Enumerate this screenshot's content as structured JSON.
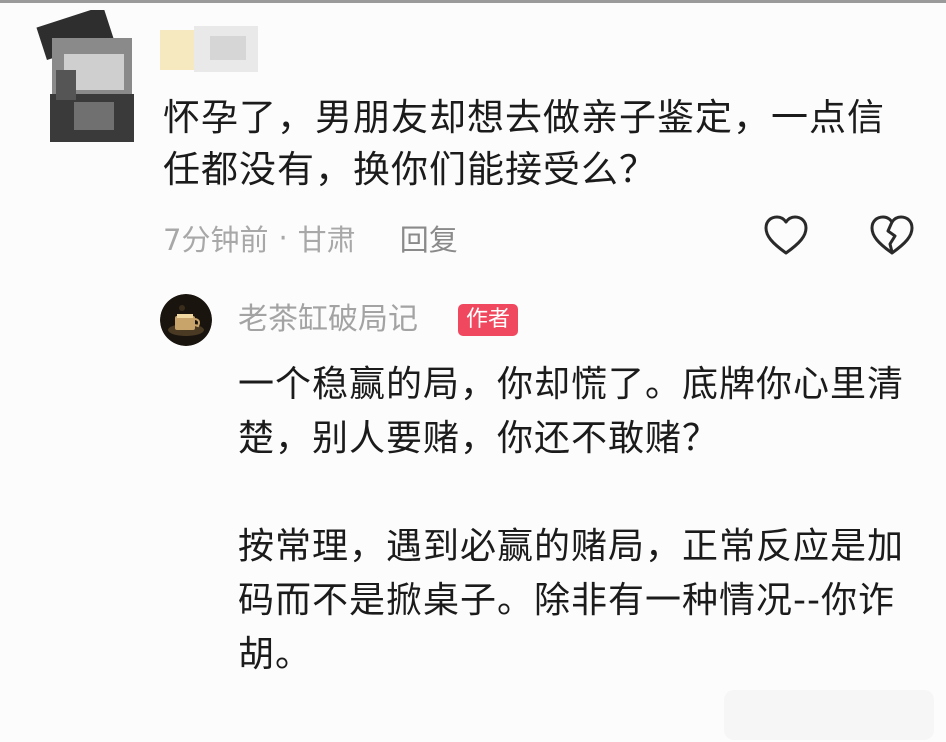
{
  "comment": {
    "text": "怀孕了，男朋友却想去做亲子鉴定，一点信任都没有，换你们能接受么？",
    "time": "7分钟前",
    "separator": "·",
    "location": "甘肃",
    "reply_label": "回复"
  },
  "icons": {
    "like": "heart-outline-icon",
    "dislike": "broken-heart-icon"
  },
  "author_reply": {
    "name": "老茶缸破局记",
    "badge": "作者",
    "paragraphs": [
      "一个稳赢的局，你却慌了。底牌你心里清楚，别人要赌，你还不敢赌？",
      "按常理，遇到必赢的赌局，正常反应是加码而不是掀桌子。除非有一种情况--你诈胡。"
    ]
  },
  "colors": {
    "text": "#1b1b1b",
    "meta": "#a8a8a8",
    "badge": "#f0485f"
  }
}
